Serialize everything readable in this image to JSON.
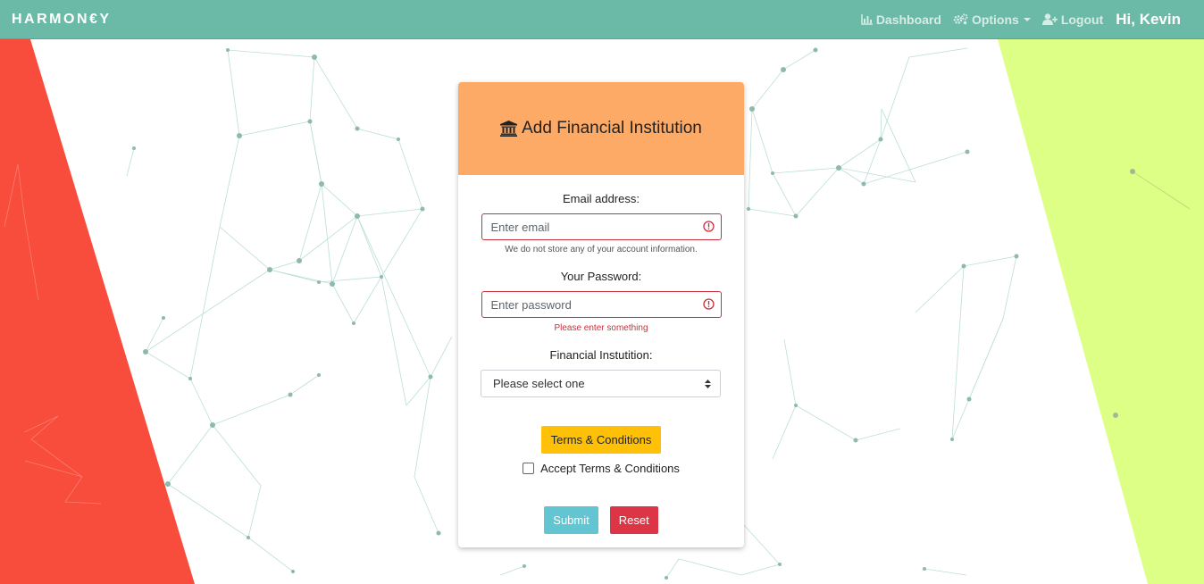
{
  "navbar": {
    "brand": "HARMON€Y",
    "links": {
      "dashboard": "Dashboard",
      "options": "Options",
      "logout": "Logout"
    },
    "greeting": "Hi, Kevin"
  },
  "card": {
    "title": "Add Financial Institution",
    "title_icon": "bank-icon",
    "email": {
      "label": "Email address:",
      "placeholder": "Enter email",
      "value": "",
      "help": "We do not store any of your account information."
    },
    "password": {
      "label": "Your Password:",
      "placeholder": "Enter password",
      "value": "",
      "error": "Please enter something"
    },
    "institution": {
      "label": "Financial Instutition:",
      "selected": "Please select one"
    },
    "terms_button": "Terms & Conditions",
    "accept_label": "Accept Terms & Conditions",
    "accept_checked": false,
    "submit": "Submit",
    "reset": "Reset"
  },
  "colors": {
    "navbar": "#6bbaa7",
    "header": "#fdaa66",
    "left_panel": "#f84d3c",
    "right_panel": "#ddff86",
    "error": "#c9303e",
    "terms": "#ffc107",
    "submit": "#63c4d2",
    "reset": "#dc3545"
  }
}
